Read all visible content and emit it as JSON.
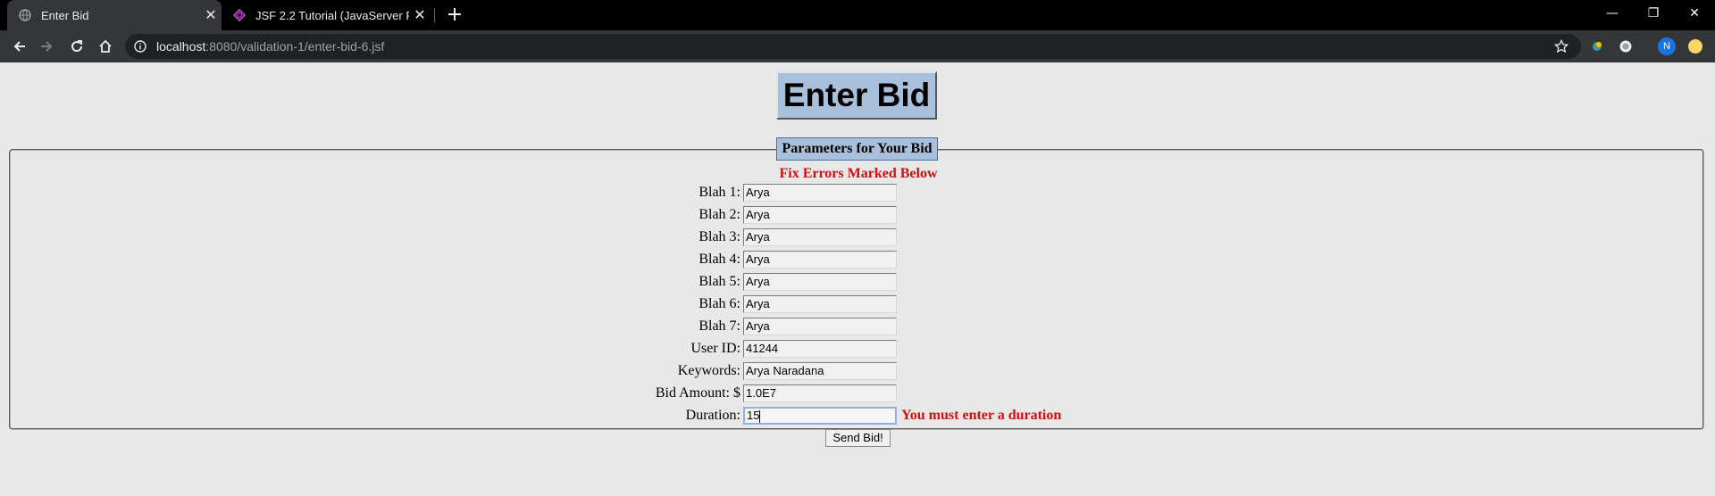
{
  "browser": {
    "tabs": [
      {
        "title": "Enter Bid",
        "active": true
      },
      {
        "title": "JSF 2.2 Tutorial (JavaServer Faces",
        "active": false
      }
    ],
    "address": {
      "host": "localhost",
      "path": ":8080/validation-1/enter-bid-6.jsf"
    },
    "profile_initial": "N",
    "colors": {
      "accent": "#1a73e8",
      "extension_yellow": "#fdd663"
    }
  },
  "page": {
    "heading": "Enter Bid",
    "legend": "Parameters for Your Bid",
    "error_summary": "Fix Errors Marked Below",
    "fields": [
      {
        "label": "Blah 1:",
        "value": "Arya"
      },
      {
        "label": "Blah 2:",
        "value": "Arya"
      },
      {
        "label": "Blah 3:",
        "value": "Arya"
      },
      {
        "label": "Blah 4:",
        "value": "Arya"
      },
      {
        "label": "Blah 5:",
        "value": "Arya"
      },
      {
        "label": "Blah 6:",
        "value": "Arya"
      },
      {
        "label": "Blah 7:",
        "value": "Arya"
      },
      {
        "label": "User ID:",
        "value": "41244"
      },
      {
        "label": "Keywords:",
        "value": "Arya Naradana"
      },
      {
        "label": "Bid Amount: $",
        "value": "1.0E7"
      },
      {
        "label": "Duration:",
        "value": "15",
        "error": "You must enter a duration"
      }
    ],
    "submit_label": "Send Bid!",
    "colors": {
      "heading_bg": "#a9c0dd",
      "error": "#d01010",
      "page_bg": "#e8e8e8"
    }
  }
}
